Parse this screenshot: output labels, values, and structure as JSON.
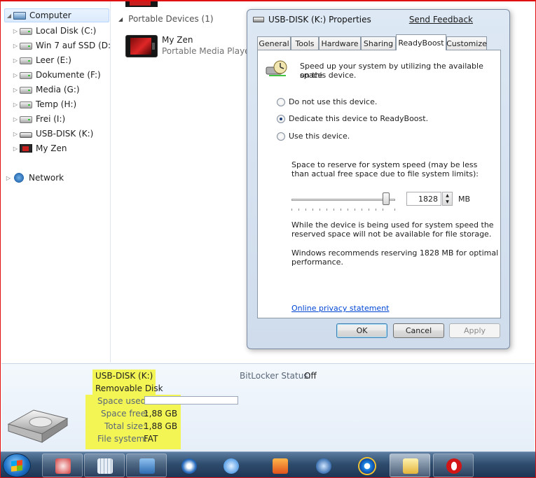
{
  "nav": {
    "items": [
      {
        "label": "Computer",
        "icon": "computer-icon",
        "arrow": "◢",
        "selected": true
      },
      {
        "label": "Local Disk (C:)",
        "icon": "drive-icon",
        "arrow": "▷"
      },
      {
        "label": "Win 7 auf SSD (D:)",
        "icon": "drive-icon",
        "arrow": "▷"
      },
      {
        "label": "Leer (E:)",
        "icon": "drive-icon",
        "arrow": "▷"
      },
      {
        "label": "Dokumente (F:)",
        "icon": "drive-icon",
        "arrow": "▷"
      },
      {
        "label": "Media (G:)",
        "icon": "drive-icon",
        "arrow": "▷"
      },
      {
        "label": "Temp (H:)",
        "icon": "drive-icon",
        "arrow": "▷"
      },
      {
        "label": "Frei (I:)",
        "icon": "drive-icon",
        "arrow": "▷"
      },
      {
        "label": "USB-DISK (K:)",
        "icon": "usb-drive-icon",
        "arrow": "▷"
      },
      {
        "label": "My Zen",
        "icon": "media-player-icon",
        "arrow": "▷"
      },
      {
        "label": "Network",
        "icon": "network-icon",
        "arrow": "▷"
      }
    ]
  },
  "main": {
    "group_header": "Portable Devices (1)",
    "group_caret": "◢",
    "device": {
      "name": "My Zen",
      "type": "Portable Media Player"
    }
  },
  "dialog": {
    "title": "USB-DISK (K:) Properties",
    "feedback_link": "Send Feedback",
    "tabs": [
      "General",
      "Tools",
      "Hardware",
      "Sharing",
      "ReadyBoost",
      "Customize"
    ],
    "active_tab": "ReadyBoost",
    "intro": [
      "Speed up your system by utilizing the available space",
      "on this device."
    ],
    "radios": [
      {
        "label": "Do not use this device.",
        "selected": false
      },
      {
        "label": "Dedicate this device to ReadyBoost.",
        "selected": true
      },
      {
        "label": "Use this device.",
        "selected": false
      }
    ],
    "reserve_text": [
      "Space to reserve for system speed (may be less",
      "than actual free space due to file system limits):"
    ],
    "reserve_value": "1828",
    "reserve_unit": "MB",
    "slider_fraction": 0.92,
    "warning_text": [
      "While the device is being used for system speed the",
      "reserved space will not be available for file storage."
    ],
    "recommend_text": [
      "Windows recommends reserving 1828 MB for optimal",
      "performance."
    ],
    "privacy_link": "Online privacy statement",
    "buttons": {
      "ok": "OK",
      "cancel": "Cancel",
      "apply": "Apply"
    }
  },
  "details": {
    "name": "USB-DISK (K:)",
    "type": "Removable Disk",
    "space_used_label": "Space used:",
    "space_free_label": "Space free:",
    "space_free_value": "1,88 GB",
    "total_size_label": "Total size:",
    "total_size_value": "1,88 GB",
    "file_system_label": "File system:",
    "file_system_value": "FAT",
    "bitlocker_label": "BitLocker Status:",
    "bitlocker_value": "Off",
    "highlight_color": "#f3f554"
  },
  "taskbar": {
    "apps": [
      "snipping-tool-icon",
      "calculator-icon",
      "control-panel-icon",
      "media-center-icon",
      "itunes-icon",
      "media-player-icon",
      "resource-monitor-icon",
      "internet-explorer-icon",
      "windows-explorer-icon",
      "opera-icon"
    ]
  }
}
